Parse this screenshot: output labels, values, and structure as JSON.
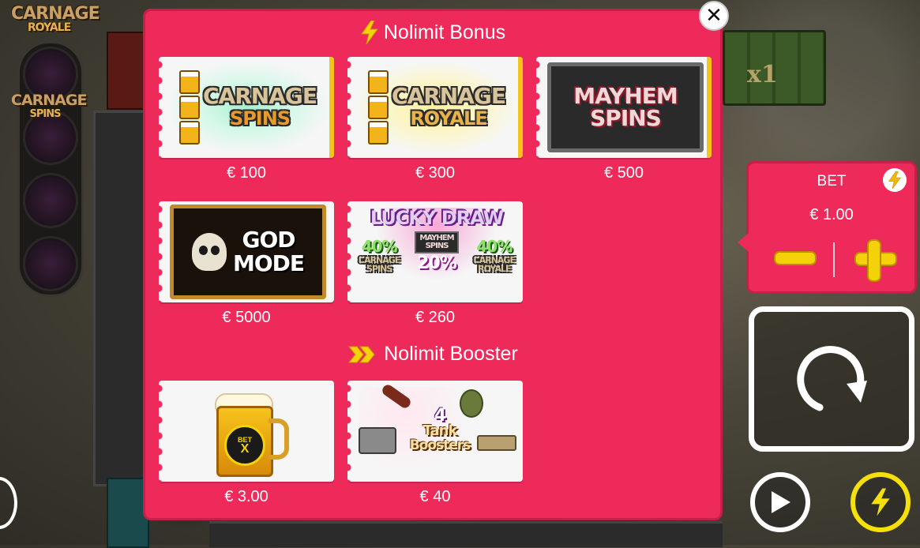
{
  "game": {
    "logo_line1": "CARNAGE",
    "logo_line2": "ROYALE",
    "slot_logo_line1": "CARNAGE",
    "slot_logo_line2": "SPINS",
    "crate_multiplier": "x1"
  },
  "bonus_section": {
    "title": "Nolimit Bonus",
    "icon": "lightning-bolt-icon",
    "items": [
      {
        "line1": "CARNAGE",
        "line2": "SPINS",
        "price": "€ 100"
      },
      {
        "line1": "CARNAGE",
        "line2": "ROYALE",
        "price": "€ 300"
      },
      {
        "line1": "MAYHEM",
        "line2": "SPINS",
        "price": "€ 500"
      },
      {
        "line1": "GOD",
        "line2": "MODE",
        "price": "€ 5000"
      },
      {
        "line1": "LUCKY DRAW",
        "pct_left": "40%",
        "pct_center": "20%",
        "pct_right": "40%",
        "left_label1": "CARNAGE",
        "left_label2": "SPINS",
        "center_label1": "MAYHEM",
        "center_label2": "SPINS",
        "right_label1": "CARNAGE",
        "right_label2": "ROYALE",
        "price": "€ 260"
      }
    ]
  },
  "booster_section": {
    "title": "Nolimit Booster",
    "icon": "double-chevron-icon",
    "items": [
      {
        "badge": "BET",
        "badge_x": "X",
        "price": "€ 3.00"
      },
      {
        "count": "4",
        "line1": "Tank",
        "line2": "Boosters",
        "price": "€ 40"
      }
    ]
  },
  "bet_panel": {
    "label": "BET",
    "value": "€ 1.00"
  },
  "colors": {
    "modal": "#ee2a5b",
    "accent_yellow": "#f5d10a",
    "text": "#ffffff"
  }
}
